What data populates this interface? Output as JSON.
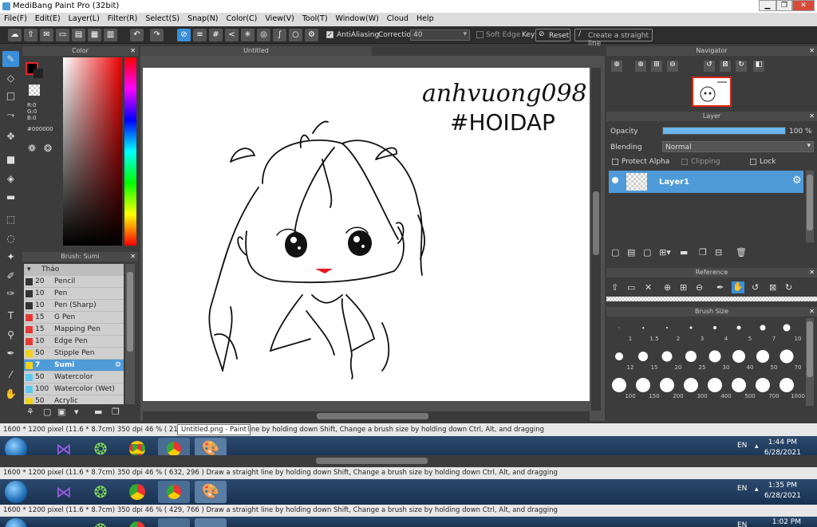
{
  "window": {
    "title": "MediBang Paint Pro (32bit)",
    "min": "▁",
    "max": "❐",
    "close": "✕"
  },
  "menu": [
    "File(F)",
    "Edit(E)",
    "Layer(L)",
    "Filter(R)",
    "Select(S)",
    "Snap(N)",
    "Color(C)",
    "View(V)",
    "Tool(T)",
    "Window(W)",
    "Cloud",
    "Help"
  ],
  "toolbar": {
    "antialiasing": "AntiAliasing",
    "correction_label": "Correction",
    "correction_value": "40",
    "soft_edge": "Soft Edge",
    "key": "Key",
    "reset": "Reset",
    "straight_line": "Create a straight line"
  },
  "color_panel": {
    "title": "Color",
    "r": "R:0",
    "g": "G:0",
    "b": "B:0",
    "hex": "#000000"
  },
  "canvas": {
    "tab": "Untitled",
    "drawing_text1": "anhvuong098",
    "drawing_text2": "#HOIDAP",
    "mouth_color": "#e11b22"
  },
  "brush_panel": {
    "title": "Brush: Sumi",
    "group": "Thảo",
    "items": [
      {
        "size": "20",
        "name": "Pencil",
        "color": "#333333"
      },
      {
        "size": "10",
        "name": "Pen",
        "color": "#333333"
      },
      {
        "size": "10",
        "name": "Pen (Sharp)",
        "color": "#333333"
      },
      {
        "size": "15",
        "name": "G Pen",
        "color": "#e53935"
      },
      {
        "size": "15",
        "name": "Mapping Pen",
        "color": "#e53935"
      },
      {
        "size": "10",
        "name": "Edge Pen",
        "color": "#e53935"
      },
      {
        "size": "50",
        "name": "Stipple Pen",
        "color": "#f2d21b"
      },
      {
        "size": "7",
        "name": "Sumi",
        "color": "#f2d21b"
      },
      {
        "size": "50",
        "name": "Watercolor",
        "color": "#5ec8f0"
      },
      {
        "size": "100",
        "name": "Watercolor (Wet)",
        "color": "#5ec8f0"
      },
      {
        "size": "50",
        "name": "Acrylic",
        "color": "#f2d21b"
      }
    ]
  },
  "navigator": {
    "title": "Navigator"
  },
  "layer_panel": {
    "title": "Layer",
    "opacity_label": "Opacity",
    "opacity_value": "100 %",
    "opacity_level": 1.0,
    "blending_label": "Blending",
    "blending_value": "Normal",
    "protect_alpha": "Protect Alpha",
    "clipping": "Clipping",
    "lock": "Lock",
    "layer_name": "Layer1"
  },
  "reference": {
    "title": "Reference"
  },
  "brush_size": {
    "title": "Brush Size",
    "sizes": [
      "1",
      "1.5",
      "2",
      "3",
      "4",
      "5",
      "7",
      "10",
      "12",
      "15",
      "20",
      "25",
      "30",
      "40",
      "50",
      "70",
      "100",
      "150",
      "200",
      "300",
      "400",
      "500",
      "700",
      "1000"
    ]
  },
  "status": [
    {
      "text": "1600 * 1200 pixel   (11.6 * 8.7cm)   350 dpi   46 %   ( 219, ",
      "tail": " line by holding down Shift, Change a brush size by holding down Ctrl, Alt, and dragging",
      "tooltip": "Untitled.png - Paint"
    },
    {
      "text": "1600 * 1200 pixel   (11.6 * 8.7cm)   350 dpi   46 %   ( 632, 296 )   Draw a straight line by holding down Shift, Change a brush size by holding down Ctrl, Alt, and dragging"
    },
    {
      "text": "1600 * 1200 pixel   (11.6 * 8.7cm)   350 dpi   46 %   ( 429, 766 )   Draw a straight line by holding down Shift, Change a brush size by holding down Ctrl, Alt, and dragging"
    }
  ],
  "taskbars": [
    {
      "lang": "EN",
      "time": "1:44 PM",
      "date": "6/28/2021"
    },
    {
      "lang": "EN",
      "time": "1:35 PM",
      "date": "6/28/2021"
    },
    {
      "lang": "EN",
      "time": "1:02 PM",
      "date": ""
    }
  ]
}
